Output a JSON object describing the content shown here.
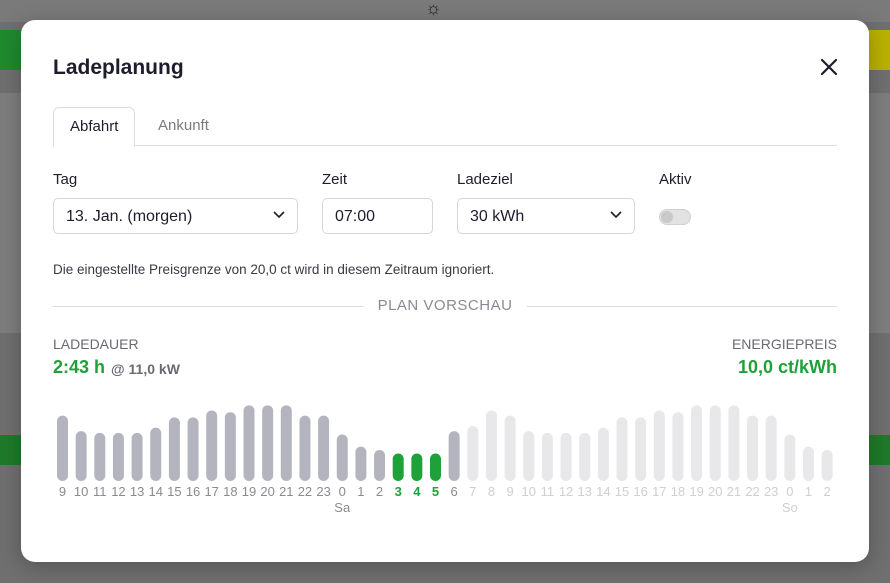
{
  "colors": {
    "accent_green": "#1fa13a",
    "bar_gray": "#b4b4be",
    "bar_light": "#e8e8ea",
    "label_gray": "#8a8a92",
    "label_light": "#cfcfd4"
  },
  "dialog": {
    "title": "Ladeplanung",
    "tabs": [
      {
        "label": "Abfahrt",
        "active": true
      },
      {
        "label": "Ankunft",
        "active": false
      }
    ],
    "fields": {
      "day": {
        "label": "Tag",
        "value": "13. Jan. (morgen)"
      },
      "time": {
        "label": "Zeit",
        "value": "07:00"
      },
      "target": {
        "label": "Ladeziel",
        "value": "30 kWh"
      },
      "active": {
        "label": "Aktiv",
        "checked": false
      }
    },
    "note": "Die eingestellte Preisgrenze von 20,0 ct wird in diesem Zeitraum ignoriert.",
    "preview_heading": "PLAN VORSCHAU",
    "stats": {
      "duration_label": "LADEDAUER",
      "duration_value": "2:43 h",
      "power": "@ 11,0 kW",
      "price_label": "ENERGIEPREIS",
      "price_value": "10,0 ct/kWh"
    }
  },
  "chart_data": {
    "type": "bar",
    "categories": [
      "9",
      "10",
      "11",
      "12",
      "13",
      "14",
      "15",
      "16",
      "17",
      "18",
      "19",
      "20",
      "21",
      "22",
      "23",
      "0",
      "1",
      "2",
      "3",
      "4",
      "5",
      "6",
      "7",
      "8",
      "9",
      "10",
      "11",
      "12",
      "13",
      "14",
      "15",
      "16",
      "17",
      "18",
      "19",
      "20",
      "21",
      "22",
      "23",
      "0",
      "1",
      "2"
    ],
    "day_labels": [
      {
        "index": 15,
        "label": "Sa"
      },
      {
        "index": 39,
        "label": "So"
      }
    ],
    "values": [
      38,
      29,
      28,
      28,
      28,
      31,
      37,
      37,
      41,
      40,
      44,
      44,
      44,
      38,
      38,
      27,
      20,
      18,
      16,
      16,
      16,
      29,
      32,
      41,
      38,
      29,
      28,
      28,
      28,
      31,
      37,
      37,
      41,
      40,
      44,
      44,
      44,
      38,
      38,
      27,
      20,
      18
    ],
    "status": [
      "past",
      "past",
      "past",
      "past",
      "past",
      "past",
      "past",
      "past",
      "past",
      "past",
      "past",
      "past",
      "past",
      "past",
      "past",
      "past",
      "past",
      "past",
      "charge",
      "charge",
      "charge",
      "past",
      "future",
      "future",
      "future",
      "future",
      "future",
      "future",
      "future",
      "future",
      "future",
      "future",
      "future",
      "future",
      "future",
      "future",
      "future",
      "future",
      "future",
      "future",
      "future",
      "future"
    ]
  }
}
